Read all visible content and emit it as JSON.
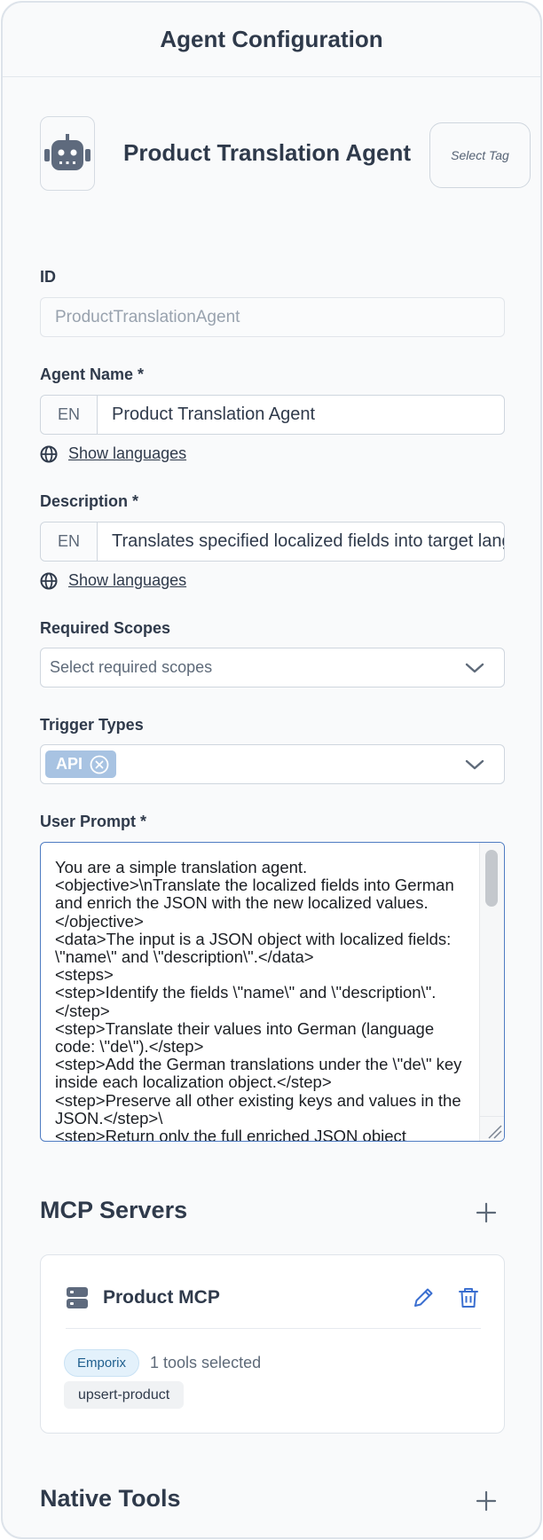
{
  "header": {
    "title": "Agent Configuration"
  },
  "agent": {
    "title": "Product Translation Agent",
    "icon": "robot-icon",
    "select_tag_label": "Select Tag"
  },
  "fields": {
    "id": {
      "label": "ID",
      "value": "ProductTranslationAgent"
    },
    "agent_name": {
      "label": "Agent Name *",
      "lang": "EN",
      "value": "Product Translation Agent",
      "show_languages": "Show languages"
    },
    "description": {
      "label": "Description *",
      "lang": "EN",
      "value": "Translates specified localized fields into target languages",
      "show_languages": "Show languages"
    },
    "required_scopes": {
      "label": "Required Scopes",
      "placeholder": "Select required scopes"
    },
    "trigger_types": {
      "label": "Trigger Types",
      "chips": [
        "API"
      ]
    },
    "user_prompt": {
      "label": "User Prompt *",
      "value": "You are a simple translation agent.\n<objective>\\nTranslate the localized fields into German and enrich the JSON with the new localized values.</objective>\n<data>The input is a JSON object with localized fields: \\\"name\\\" and \\\"description\\\".</data>\n<steps>\n<step>Identify the fields \\\"name\\\" and \\\"description\\\".</step>\n<step>Translate their values into German (language code: \\\"de\\\").</step>\n<step>Add the German translations under the \\\"de\\\" key inside each localization object.</step>\n<step>Preserve all other existing keys and values in the JSON.</step>\\\n<step>Return only the full enriched JSON object"
    }
  },
  "mcp_servers": {
    "title": "MCP Servers",
    "items": [
      {
        "name": "Product MCP",
        "badge": "Emporix",
        "tools_count": "1 tools selected",
        "tools": [
          "upsert-product"
        ]
      }
    ]
  },
  "native_tools": {
    "title": "Native Tools"
  },
  "colors": {
    "accent": "#4f7cc2",
    "chip": "#a8c3e2",
    "badge_bg": "#e3f1fb",
    "text": "#2f3a4b"
  }
}
